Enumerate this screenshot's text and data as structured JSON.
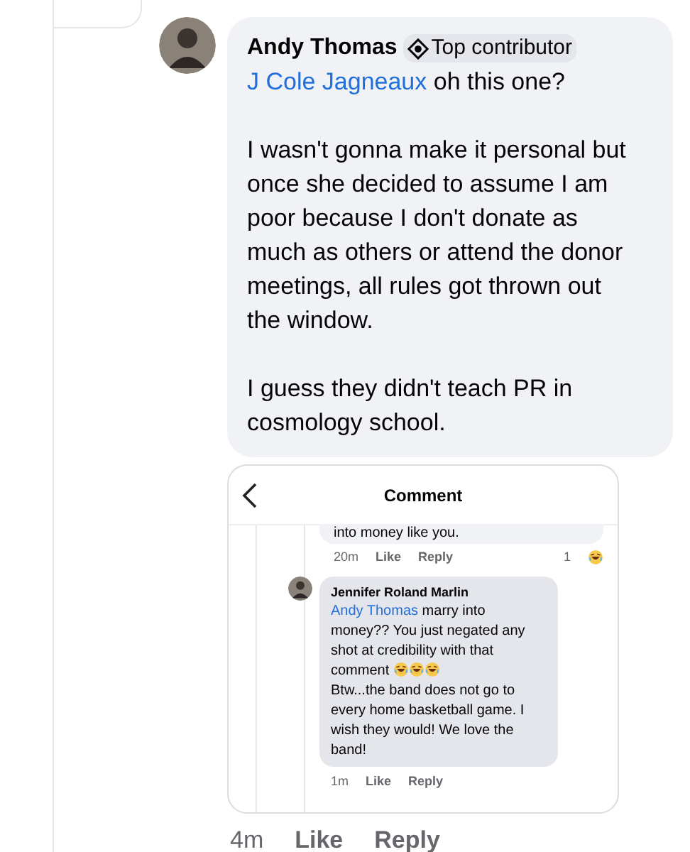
{
  "comment": {
    "author": "Andy Thomas",
    "badge": "Top contributor",
    "mention": "J Cole Jagneaux",
    "paragraphs": [
      "oh this one?",
      "I wasn't gonna make it personal but once she decided to assume I am poor because I don't donate as much as others or attend the donor meetings, all rules got thrown out the window.",
      "I guess they didn't teach PR in cosmology school."
    ],
    "time": "4m",
    "actions": [
      "Like",
      "Reply"
    ]
  },
  "screenshot": {
    "title": "Comment",
    "prev_text": "into money like you.",
    "prev_time": "20m",
    "prev_actions": [
      "Like",
      "Reply"
    ],
    "prev_reaction_count": "1",
    "reply": {
      "author": "Jennifer Roland Marlin",
      "mention": "Andy Thomas",
      "text_1": "marry into money?? You just negated  any shot at credibility with that comment",
      "emojis": [
        {
          "kind": "laugh"
        },
        {
          "kind": "laugh"
        },
        {
          "kind": "laugh"
        }
      ],
      "text_2": "Btw...the band does not go to every home basketball game. I wish they would! We love the band!",
      "time": "1m",
      "actions": [
        "Like",
        "Reply"
      ]
    }
  }
}
